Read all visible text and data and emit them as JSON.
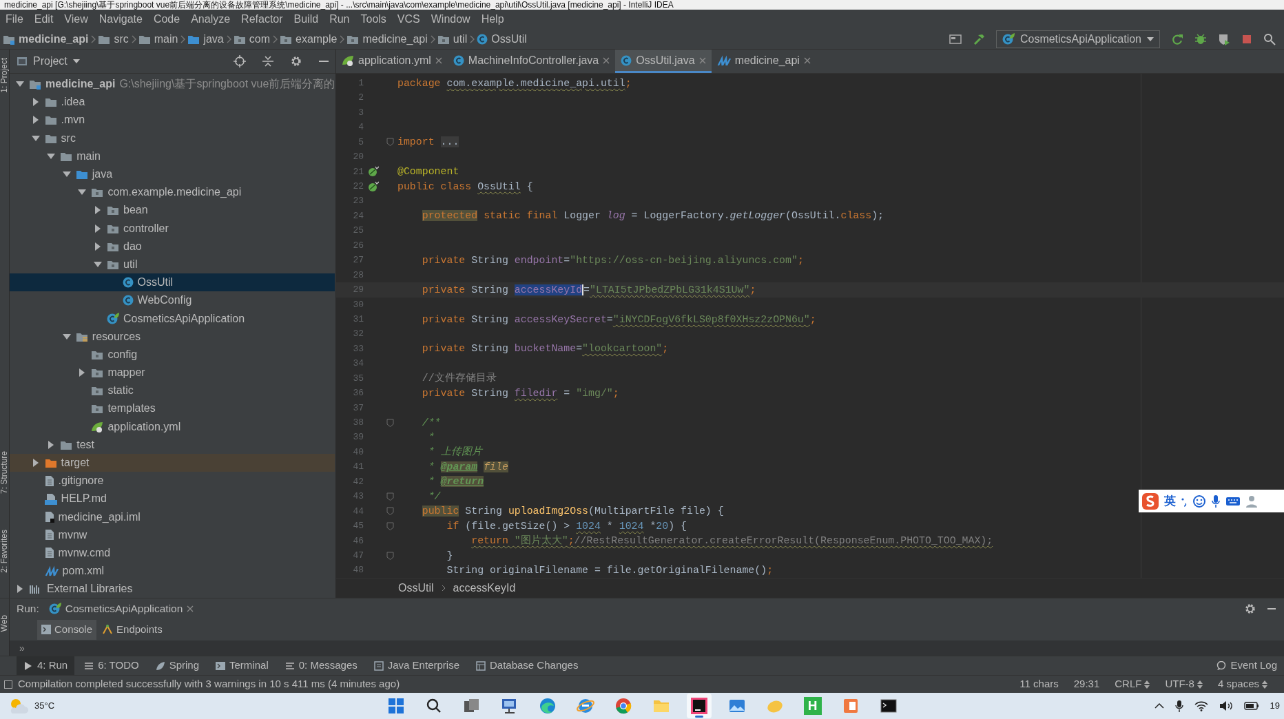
{
  "window": {
    "title": "medicine_api [G:\\shejiing\\基于springboot vue前后端分离的设备故障管理系统\\medicine_api] - ...\\src\\main\\java\\com\\example\\medicine_api\\util\\OssUtil.java [medicine_api] - IntelliJ IDEA"
  },
  "menu": [
    "File",
    "Edit",
    "View",
    "Navigate",
    "Code",
    "Analyze",
    "Refactor",
    "Build",
    "Run",
    "Tools",
    "VCS",
    "Window",
    "Help"
  ],
  "nav_bar": {
    "crumbs": [
      {
        "label": "medicine_api",
        "kind": "module"
      },
      {
        "label": "src",
        "kind": "folder"
      },
      {
        "label": "main",
        "kind": "folder"
      },
      {
        "label": "java",
        "kind": "folder-src"
      },
      {
        "label": "com",
        "kind": "package"
      },
      {
        "label": "example",
        "kind": "package"
      },
      {
        "label": "medicine_api",
        "kind": "package"
      },
      {
        "label": "util",
        "kind": "package"
      },
      {
        "label": "OssUtil",
        "kind": "class"
      }
    ],
    "run_config": "CosmeticsApiApplication"
  },
  "side_tabs": [
    "1: Project",
    "7: Structure",
    "2: Favorites"
  ],
  "project_panel": {
    "title": "Project",
    "tree": [
      {
        "label": "medicine_api",
        "path": "G:\\shejiing\\基于springboot vue前后端分离的",
        "kind": "module",
        "expanded": true,
        "selected": false,
        "children": [
          {
            "label": ".idea",
            "kind": "folder",
            "expanded": false,
            "selected": false
          },
          {
            "label": ".mvn",
            "kind": "folder",
            "expanded": false,
            "selected": false
          },
          {
            "label": "src",
            "kind": "folder",
            "expanded": true,
            "selected": false,
            "children": [
              {
                "label": "main",
                "kind": "folder",
                "expanded": true,
                "selected": false,
                "children": [
                  {
                    "label": "java",
                    "kind": "folder-src",
                    "expanded": true,
                    "selected": false,
                    "children": [
                      {
                        "label": "com.example.medicine_api",
                        "kind": "package",
                        "expanded": true,
                        "selected": false,
                        "children": [
                          {
                            "label": "bean",
                            "kind": "package",
                            "expanded": false,
                            "selected": false
                          },
                          {
                            "label": "controller",
                            "kind": "package",
                            "expanded": false,
                            "selected": false
                          },
                          {
                            "label": "dao",
                            "kind": "package",
                            "expanded": false,
                            "selected": false
                          },
                          {
                            "label": "util",
                            "kind": "package",
                            "expanded": true,
                            "selected": false,
                            "children": [
                              {
                                "label": "OssUtil",
                                "kind": "class",
                                "selected": true
                              },
                              {
                                "label": "WebConfig",
                                "kind": "class",
                                "selected": false
                              }
                            ]
                          },
                          {
                            "label": "CosmeticsApiApplication",
                            "kind": "spring-class",
                            "selected": false
                          }
                        ]
                      }
                    ]
                  },
                  {
                    "label": "resources",
                    "kind": "resources",
                    "expanded": true,
                    "selected": false,
                    "children": [
                      {
                        "label": "config",
                        "kind": "package",
                        "selected": false
                      },
                      {
                        "label": "mapper",
                        "kind": "package",
                        "expanded": false,
                        "selected": false
                      },
                      {
                        "label": "static",
                        "kind": "package",
                        "selected": false
                      },
                      {
                        "label": "templates",
                        "kind": "package",
                        "selected": false
                      },
                      {
                        "label": "application.yml",
                        "kind": "yml",
                        "selected": false
                      }
                    ]
                  }
                ]
              },
              {
                "label": "test",
                "kind": "folder",
                "expanded": false,
                "selected": false
              }
            ]
          },
          {
            "label": "target",
            "kind": "excluded",
            "expanded": false,
            "selected": false
          },
          {
            "label": ".gitignore",
            "kind": "file",
            "selected": false
          },
          {
            "label": "HELP.md",
            "kind": "md",
            "selected": false
          },
          {
            "label": "medicine_api.iml",
            "kind": "iml",
            "selected": false
          },
          {
            "label": "mvnw",
            "kind": "file",
            "selected": false
          },
          {
            "label": "mvnw.cmd",
            "kind": "file",
            "selected": false
          },
          {
            "label": "pom.xml",
            "kind": "maven",
            "selected": false
          }
        ]
      },
      {
        "label": "External Libraries",
        "kind": "libraries",
        "expanded": false,
        "selected": false
      }
    ]
  },
  "editor": {
    "tabs": [
      {
        "label": "application.yml",
        "kind": "yml",
        "selected": false
      },
      {
        "label": "MachineInfoController.java",
        "kind": "class",
        "selected": false
      },
      {
        "label": "OssUtil.java",
        "kind": "class",
        "selected": true
      },
      {
        "label": "medicine_api",
        "kind": "maven",
        "selected": false
      }
    ],
    "lines": [
      {
        "number": "1",
        "segments": [
          {
            "text": "package ",
            "kind": "kw"
          },
          {
            "text": "com.example.medicine_api.util",
            "kind": "plain",
            "squiggle": true
          },
          {
            "text": ";",
            "kind": "kw"
          }
        ]
      },
      {
        "number": "2"
      },
      {
        "number": "3"
      },
      {
        "number": "4"
      },
      {
        "number": "5",
        "fold": true,
        "segments": [
          {
            "text": "import ",
            "kind": "kw"
          },
          {
            "text": "...",
            "kind": "folded"
          }
        ]
      },
      {
        "number": "20"
      },
      {
        "number": "21",
        "gutter_marker": true,
        "segments": [
          {
            "text": "@Component",
            "kind": "ann"
          }
        ]
      },
      {
        "number": "22",
        "gutter_marker": true,
        "segments": [
          {
            "text": "public class ",
            "kind": "kw"
          },
          {
            "text": "OssUtil",
            "kind": "plain",
            "squiggle": true
          },
          {
            "text": " {",
            "kind": "plain"
          }
        ]
      },
      {
        "number": "23"
      },
      {
        "number": "24",
        "segments": [
          {
            "text": "    protected",
            "kind": "kw",
            "marked": true
          },
          {
            "text": " static final ",
            "kind": "kw"
          },
          {
            "text": "Logger ",
            "kind": "plain"
          },
          {
            "text": "log",
            "kind": "field-italic"
          },
          {
            "text": " = LoggerFactory.",
            "kind": "plain"
          },
          {
            "text": "getLogger",
            "kind": "italic"
          },
          {
            "text": "(OssUtil.",
            "kind": "plain"
          },
          {
            "text": "class",
            "kind": "kw"
          },
          {
            "text": ");",
            "kind": "plain"
          }
        ]
      },
      {
        "number": "25"
      },
      {
        "number": "26"
      },
      {
        "number": "27",
        "segments": [
          {
            "text": "    private ",
            "kind": "kw"
          },
          {
            "text": "String ",
            "kind": "plain"
          },
          {
            "text": "endpoint",
            "kind": "field"
          },
          {
            "text": "=",
            "kind": "plain"
          },
          {
            "text": "\"https://oss-cn-beijing.aliyuncs.com\"",
            "kind": "str"
          },
          {
            "text": ";",
            "kind": "kw"
          }
        ]
      },
      {
        "number": "28"
      },
      {
        "number": "29",
        "current": true,
        "segments": [
          {
            "text": "    private ",
            "kind": "kw"
          },
          {
            "text": "String ",
            "kind": "plain"
          },
          {
            "text": "accessKeyId",
            "kind": "field",
            "selected": true
          },
          {
            "text": "=",
            "kind": "plain"
          },
          {
            "text": "\"LTAI5tJPbedZPbLG31k4S1Uw\"",
            "kind": "str",
            "squiggle": true
          },
          {
            "text": ";",
            "kind": "kw"
          }
        ]
      },
      {
        "number": "30"
      },
      {
        "number": "31",
        "segments": [
          {
            "text": "    private ",
            "kind": "kw"
          },
          {
            "text": "String ",
            "kind": "plain"
          },
          {
            "text": "accessKeySecret",
            "kind": "field"
          },
          {
            "text": "=",
            "kind": "plain"
          },
          {
            "text": "\"iNYCDFogV6fkLS0p8f0XHsz2zOPN6u\"",
            "kind": "str",
            "squiggle": true
          },
          {
            "text": ";",
            "kind": "kw"
          }
        ]
      },
      {
        "number": "32"
      },
      {
        "number": "33",
        "segments": [
          {
            "text": "    private ",
            "kind": "kw"
          },
          {
            "text": "String ",
            "kind": "plain"
          },
          {
            "text": "bucketName",
            "kind": "field"
          },
          {
            "text": "=",
            "kind": "plain"
          },
          {
            "text": "\"lookcartoon\"",
            "kind": "str",
            "squiggle": true
          },
          {
            "text": ";",
            "kind": "kw"
          }
        ]
      },
      {
        "number": "34"
      },
      {
        "number": "35",
        "segments": [
          {
            "text": "    //文件存储目录",
            "kind": "comment"
          }
        ]
      },
      {
        "number": "36",
        "segments": [
          {
            "text": "    private ",
            "kind": "kw"
          },
          {
            "text": "String ",
            "kind": "plain"
          },
          {
            "text": "filedir",
            "kind": "field",
            "squiggle": true
          },
          {
            "text": " = ",
            "kind": "plain"
          },
          {
            "text": "\"img/\"",
            "kind": "str"
          },
          {
            "text": ";",
            "kind": "kw"
          }
        ]
      },
      {
        "number": "37"
      },
      {
        "number": "38",
        "fold": true,
        "segments": [
          {
            "text": "    /**",
            "kind": "doc"
          }
        ]
      },
      {
        "number": "39",
        "segments": [
          {
            "text": "     *",
            "kind": "doc"
          }
        ]
      },
      {
        "number": "40",
        "segments": [
          {
            "text": "     * 上传图片",
            "kind": "doc"
          }
        ]
      },
      {
        "number": "41",
        "segments": [
          {
            "text": "     * ",
            "kind": "doc"
          },
          {
            "text": "@param",
            "kind": "doctag",
            "marked": true
          },
          {
            "text": " file",
            "kind": "docparam",
            "marked": true
          }
        ]
      },
      {
        "number": "42",
        "segments": [
          {
            "text": "     * ",
            "kind": "doc"
          },
          {
            "text": "@return",
            "kind": "doctag",
            "marked": true
          }
        ]
      },
      {
        "number": "43",
        "fold": true,
        "segments": [
          {
            "text": "     */",
            "kind": "doc"
          }
        ]
      },
      {
        "number": "44",
        "fold": true,
        "segments": [
          {
            "text": "    public",
            "kind": "kw",
            "marked": true
          },
          {
            "text": " String ",
            "kind": "plain"
          },
          {
            "text": "uploadImg2Oss",
            "kind": "method"
          },
          {
            "text": "(MultipartFile file) {",
            "kind": "plain"
          }
        ]
      },
      {
        "number": "45",
        "fold": true,
        "segments": [
          {
            "text": "        if ",
            "kind": "kw"
          },
          {
            "text": "(file.getSize() > ",
            "kind": "plain"
          },
          {
            "text": "1024",
            "kind": "num",
            "squiggle": true
          },
          {
            "text": " * ",
            "kind": "plain"
          },
          {
            "text": "1024",
            "kind": "num",
            "squiggle": true
          },
          {
            "text": " *",
            "kind": "plain"
          },
          {
            "text": "20",
            "kind": "num"
          },
          {
            "text": ") {",
            "kind": "plain"
          }
        ]
      },
      {
        "number": "46",
        "segments": [
          {
            "text": "            return ",
            "kind": "kw",
            "squiggle": true
          },
          {
            "text": "\"图片太大\"",
            "kind": "str",
            "squiggle": true
          },
          {
            "text": ";",
            "kind": "kw",
            "squiggle": true
          },
          {
            "text": "//RestResultGenerator.createErrorResult(ResponseEnum.PHOTO_TOO_MAX);",
            "kind": "comment",
            "squiggle": true
          }
        ]
      },
      {
        "number": "47",
        "fold": true,
        "segments": [
          {
            "text": "        }",
            "kind": "plain"
          }
        ]
      },
      {
        "number": "48",
        "segments": [
          {
            "text": "        String originalFilename = file.getOriginalFilename()",
            "kind": "plain"
          },
          {
            "text": ";",
            "kind": "kw"
          }
        ]
      }
    ],
    "breadcrumb": [
      "OssUtil",
      "accessKeyId"
    ]
  },
  "ime_bar": {
    "label": "英"
  },
  "run_panel": {
    "label": "Run:",
    "side_tab": "Web",
    "tabs": [
      {
        "label": "CosmeticsApiApplication"
      }
    ],
    "subtabs": [
      {
        "label": "Console",
        "kind": "console",
        "selected": true
      },
      {
        "label": "Endpoints",
        "kind": "endpoints",
        "selected": false
      }
    ],
    "overflow": "»"
  },
  "tool_strip": {
    "items": [
      {
        "label": "4: Run",
        "kind": "run",
        "selected": true
      },
      {
        "label": "6: TODO",
        "kind": "todo",
        "selected": false
      },
      {
        "label": "Spring",
        "kind": "spring",
        "selected": false
      },
      {
        "label": "Terminal",
        "kind": "terminal",
        "selected": false
      },
      {
        "label": "0: Messages",
        "kind": "messages",
        "selected": false
      },
      {
        "label": "Java Enterprise",
        "kind": "enterprise",
        "selected": false
      },
      {
        "label": "Database Changes",
        "kind": "database",
        "selected": false
      }
    ],
    "event_log": "Event Log"
  },
  "status_bar": {
    "message": "Compilation completed successfully with 3 warnings in 10 s 411 ms (4 minutes ago)",
    "items": [
      {
        "label": "11 chars",
        "dropdown": false
      },
      {
        "label": "29:31",
        "dropdown": false
      },
      {
        "label": "CRLF",
        "dropdown": true
      },
      {
        "label": "UTF-8",
        "dropdown": true
      },
      {
        "label": "4 spaces",
        "dropdown": true
      }
    ]
  },
  "taskbar": {
    "weather": "35°C",
    "apps": [
      {
        "kind": "windows",
        "active": false
      },
      {
        "kind": "search",
        "active": false
      },
      {
        "kind": "taskview",
        "active": false
      },
      {
        "kind": "network",
        "active": false
      },
      {
        "kind": "edge",
        "active": false
      },
      {
        "kind": "ie",
        "active": false
      },
      {
        "kind": "chrome",
        "active": false
      },
      {
        "kind": "folder",
        "active": false
      },
      {
        "kind": "ide",
        "active": true
      },
      {
        "kind": "photos",
        "active": false
      },
      {
        "kind": "yellow",
        "active": false
      },
      {
        "kind": "letter",
        "label": "H",
        "active": false
      },
      {
        "kind": "office",
        "active": false
      },
      {
        "kind": "terminal",
        "active": false
      }
    ],
    "clock": "19"
  }
}
